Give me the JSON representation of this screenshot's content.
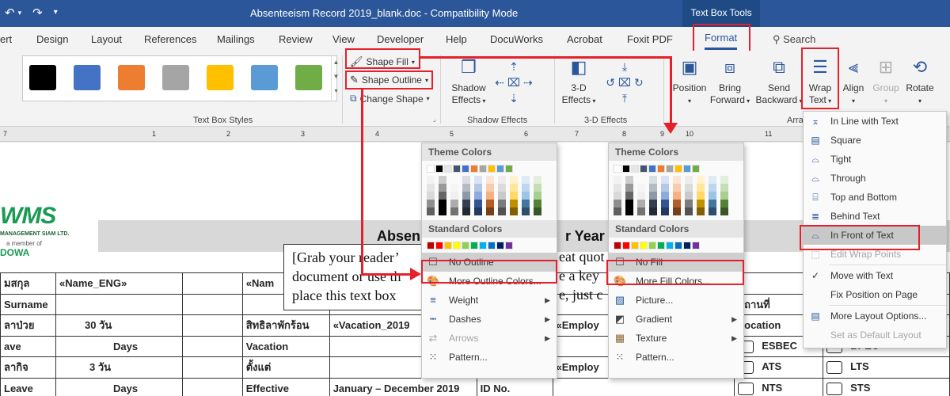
{
  "titlebar": {
    "title": "Absenteeism Record 2019_blank.doc  -  Compatibility Mode",
    "context_tab": "Text Box Tools"
  },
  "tabs": [
    "ert",
    "Design",
    "Layout",
    "References",
    "Mailings",
    "Review",
    "View",
    "Developer",
    "Help",
    "DocuWorks",
    "Acrobat",
    "Foxit PDF",
    "Format"
  ],
  "search": "Search",
  "ribbon": {
    "text_box_styles_label": "Text Box Styles",
    "style_swatches": [
      "#000000",
      "#4472c4",
      "#ed7d31",
      "#a5a5a5",
      "#ffc000",
      "#5b9bd5",
      "#70ad47"
    ],
    "shape_fill": "Shape Fill",
    "shape_outline": "Shape Outline",
    "change_shape": "Change Shape",
    "shadow_effects_btn": [
      "Shadow",
      "Effects"
    ],
    "shadow_effects_label": "Shadow Effects",
    "three_d_btn": [
      "3-D",
      "Effects"
    ],
    "three_d_label": "3-D Effects",
    "position": "Position",
    "bring_forward": [
      "Bring",
      "Forward"
    ],
    "send_backward": [
      "Send",
      "Backward"
    ],
    "wrap_text": [
      "Wrap",
      "Text"
    ],
    "align": "Align",
    "group": "Group",
    "rotate": "Rotate",
    "arrange_label": "Arra"
  },
  "ruler": {
    "numbers": [
      "7",
      "1",
      "2",
      "3",
      "4",
      "5",
      "6",
      "7",
      "8",
      "9",
      "10",
      "11"
    ]
  },
  "document": {
    "logo_main": "WMS",
    "logo_sub": "MANAGEMENT SIAM LTD.",
    "logo_member": "a member of",
    "logo_dowa": "DOWA",
    "heading_left": "Absen",
    "heading_right": "r Year 2",
    "textbox_lines": [
      "[Grab your reader’",
      "document or use th",
      "place this text box"
    ],
    "textbox_right_lines": [
      "eat quot",
      "e a key",
      "e, just c"
    ],
    "rows": [
      [
        "มสกุล",
        "«Name_ENG»",
        "",
        "«Nam",
        "",
        "",
        "",
        "",
        ""
      ],
      [
        "Surname",
        "",
        "",
        "",
        "",
        "",
        "",
        "สถานที่",
        ""
      ],
      [
        "ลาป่วย",
        "30    วัน",
        "",
        "สิทธิลาพักร้อน",
        "«Vacation_2019",
        "",
        "«Employ",
        "Location",
        ""
      ],
      [
        "ave",
        "Days",
        "",
        "Vacation",
        "Days",
        "",
        "",
        "ESBEC",
        "BPEC"
      ],
      [
        "ลากิจ",
        "3    วัน",
        "",
        "ตั้งแต่",
        "",
        "",
        "«Employ",
        "ATS",
        "LTS"
      ],
      [
        "Leave",
        "Days",
        "",
        "Effective",
        "January – December 2019",
        "ID No.",
        "",
        "NTS",
        "STS"
      ]
    ]
  },
  "outline_palette": {
    "theme_colors": "Theme Colors",
    "standard_colors": "Standard Colors",
    "items": [
      {
        "label": "No Outline",
        "icon": "empty-box-icon"
      },
      {
        "label": "More Outline Colors...",
        "icon": "palette-icon"
      },
      {
        "label": "Weight",
        "icon": "line-weight-icon",
        "submenu": true
      },
      {
        "label": "Dashes",
        "icon": "dashes-icon",
        "submenu": true
      },
      {
        "label": "Arrows",
        "icon": "arrows-icon",
        "submenu": true,
        "disabled": true
      },
      {
        "label": "Pattern...",
        "icon": "pattern-icon"
      }
    ]
  },
  "fill_palette": {
    "theme_colors": "Theme Colors",
    "standard_colors": "Standard Colors",
    "items": [
      {
        "label": "No Fill",
        "icon": "empty-box-icon"
      },
      {
        "label": "More Fill Colors...",
        "icon": "palette-icon"
      },
      {
        "label": "Picture...",
        "icon": "picture-icon"
      },
      {
        "label": "Gradient",
        "icon": "gradient-icon",
        "submenu": true
      },
      {
        "label": "Texture",
        "icon": "texture-icon",
        "submenu": true
      },
      {
        "label": "Pattern...",
        "icon": "pattern-icon"
      }
    ]
  },
  "theme_top_colors": [
    "#ffffff",
    "#000000",
    "#e7e6e6",
    "#44546a",
    "#4472c4",
    "#ed7d31",
    "#a5a5a5",
    "#ffc000",
    "#5b9bd5",
    "#70ad47"
  ],
  "standard_colors": [
    "#c00000",
    "#ff0000",
    "#ffc000",
    "#ffff00",
    "#92d050",
    "#00b050",
    "#00b0f0",
    "#0070c0",
    "#002060",
    "#7030a0"
  ],
  "wrap_menu": {
    "items": [
      {
        "label": "In Line with Text",
        "icon": "inline-text-icon"
      },
      {
        "label": "Square",
        "icon": "square-wrap-icon"
      },
      {
        "label": "Tight",
        "icon": "tight-wrap-icon"
      },
      {
        "label": "Through",
        "icon": "through-wrap-icon"
      },
      {
        "label": "Top and Bottom",
        "icon": "top-bottom-wrap-icon"
      },
      {
        "label": "Behind Text",
        "icon": "behind-text-icon"
      },
      {
        "label": "In Front of Text",
        "icon": "in-front-text-icon",
        "highlight": true
      },
      {
        "label": "Edit Wrap Points",
        "icon": "edit-wrap-points-icon",
        "disabled": true
      },
      {
        "label": "Move with Text",
        "icon": "check-icon",
        "checked": true
      },
      {
        "label": "Fix Position on Page",
        "icon": ""
      },
      {
        "label": "More Layout Options...",
        "icon": "layout-options-icon"
      },
      {
        "label": "Set as Default Layout",
        "icon": "",
        "disabled": true
      }
    ]
  }
}
